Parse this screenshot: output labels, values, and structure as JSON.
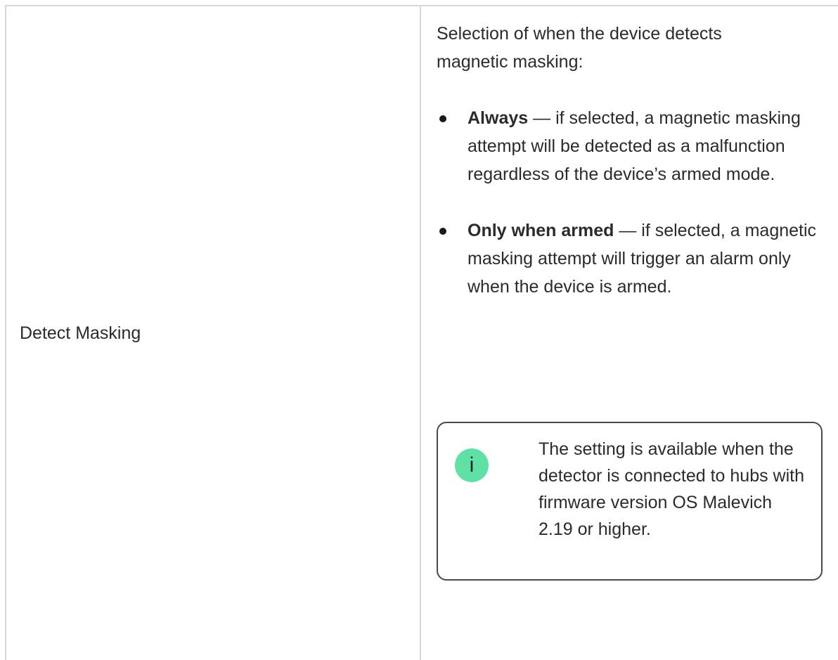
{
  "left": {
    "label": "Detect Masking"
  },
  "right": {
    "intro": "Selection of when the device detects magnetic masking:",
    "options": [
      {
        "term": "Always",
        "description": " — if selected, a magnetic masking attempt will be detected as a malfunction regardless of the device’s armed mode."
      },
      {
        "term": "Only when armed",
        "description": " — if selected, a magnetic masking attempt will trigger an alarm only when the device is armed."
      }
    ],
    "note": {
      "icon": "info-icon",
      "icon_glyph": "i",
      "icon_color": "#5fe0a4",
      "text": "The setting is available when the detector is connected to hubs with firmware version OS Malevich 2.19 or higher."
    }
  }
}
